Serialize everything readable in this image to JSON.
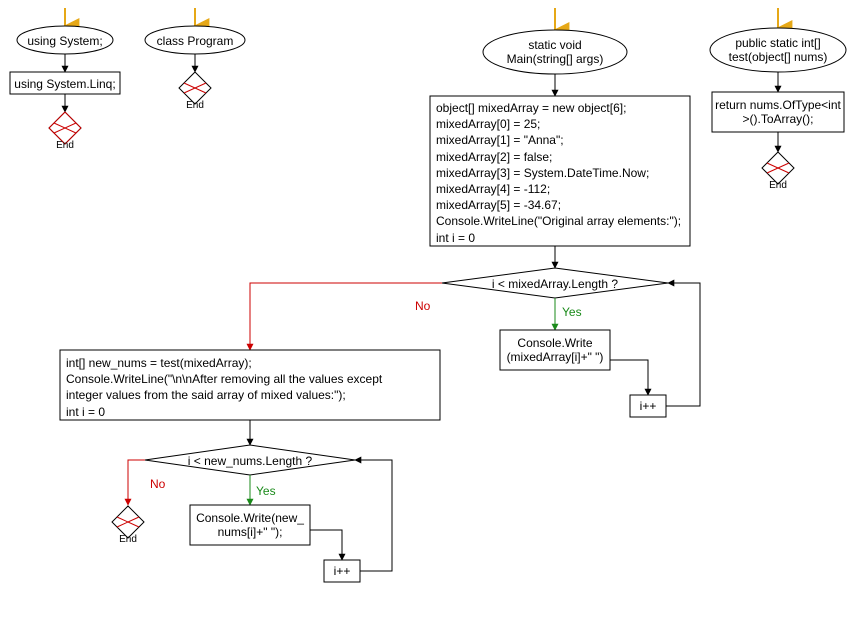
{
  "flow": {
    "using_system": "using System;",
    "class_program": "class Program",
    "using_linq": "using System.Linq;",
    "end": "End",
    "main_sig": "static void\nMain(string[] args)",
    "test_sig": "public static int[]\ntest(object[] nums)",
    "test_body": "return nums.OfType<int\n>().ToArray();",
    "block1": "object[] mixedArray = new object[6];\nmixedArray[0] = 25;\nmixedArray[1] = \"Anna\";\nmixedArray[2] = false;\nmixedArray[3] = System.DateTime.Now;\nmixedArray[4] = -112;\nmixedArray[5] = -34.67;\nConsole.WriteLine(\"Original array elements:\");\nint i = 0",
    "cond1": "i < mixedArray.Length ?",
    "loop1_body": "Console.Write\n(mixedArray[i]+\" \")",
    "incr": "i++",
    "block2": "int[] new_nums = test(mixedArray);\nConsole.WriteLine(\"\\n\\nAfter removing all the values except\ninteger values from the said array of mixed values:\");\nint i = 0",
    "cond2": "i < new_nums.Length ?",
    "loop2_body": "Console.Write(new_\nnums[i]+\" \");",
    "yes": "Yes",
    "no": "No"
  },
  "chart_data": {
    "type": "flowchart",
    "title": "",
    "subflows": [
      {
        "name": "using System;",
        "nodes": [
          {
            "id": "u1",
            "type": "start",
            "label": "using System;"
          },
          {
            "id": "u2",
            "type": "process",
            "label": "using System.Linq;"
          },
          {
            "id": "u3",
            "type": "end",
            "label": "End"
          }
        ],
        "edges": [
          [
            "u1",
            "u2"
          ],
          [
            "u2",
            "u3"
          ]
        ]
      },
      {
        "name": "class Program",
        "nodes": [
          {
            "id": "c1",
            "type": "start",
            "label": "class Program"
          },
          {
            "id": "c2",
            "type": "end",
            "label": "End"
          }
        ],
        "edges": [
          [
            "c1",
            "c2"
          ]
        ]
      },
      {
        "name": "static void Main(string[] args)",
        "nodes": [
          {
            "id": "m1",
            "type": "start",
            "label": "static void Main(string[] args)"
          },
          {
            "id": "m2",
            "type": "process",
            "label": "object[] mixedArray = new object[6]; mixedArray[0] = 25; mixedArray[1] = \"Anna\"; mixedArray[2] = false; mixedArray[3] = System.DateTime.Now; mixedArray[4] = -112; mixedArray[5] = -34.67; Console.WriteLine(\"Original array elements:\"); int i = 0"
          },
          {
            "id": "m3",
            "type": "decision",
            "label": "i < mixedArray.Length ?"
          },
          {
            "id": "m4",
            "type": "process",
            "label": "Console.Write(mixedArray[i]+\" \")"
          },
          {
            "id": "m5",
            "type": "process",
            "label": "i++"
          },
          {
            "id": "m6",
            "type": "process",
            "label": "int[] new_nums = test(mixedArray); Console.WriteLine(\"\\n\\nAfter removing all the values except integer values from the said array of mixed values:\"); int i = 0"
          },
          {
            "id": "m7",
            "type": "decision",
            "label": "i < new_nums.Length ?"
          },
          {
            "id": "m8",
            "type": "process",
            "label": "Console.Write(new_nums[i]+\" \");"
          },
          {
            "id": "m9",
            "type": "process",
            "label": "i++"
          },
          {
            "id": "m10",
            "type": "end",
            "label": "End"
          }
        ],
        "edges": [
          [
            "m1",
            "m2"
          ],
          [
            "m2",
            "m3"
          ],
          [
            "m3",
            "m4",
            "Yes"
          ],
          [
            "m4",
            "m5"
          ],
          [
            "m5",
            "m3"
          ],
          [
            "m3",
            "m6",
            "No"
          ],
          [
            "m6",
            "m7"
          ],
          [
            "m7",
            "m8",
            "Yes"
          ],
          [
            "m8",
            "m9"
          ],
          [
            "m9",
            "m7"
          ],
          [
            "m7",
            "m10",
            "No"
          ]
        ]
      },
      {
        "name": "public static int[] test(object[] nums)",
        "nodes": [
          {
            "id": "t1",
            "type": "start",
            "label": "public static int[] test(object[] nums)"
          },
          {
            "id": "t2",
            "type": "process",
            "label": "return nums.OfType<int>().ToArray();"
          },
          {
            "id": "t3",
            "type": "end",
            "label": "End"
          }
        ],
        "edges": [
          [
            "t1",
            "t2"
          ],
          [
            "t2",
            "t3"
          ]
        ]
      }
    ]
  }
}
